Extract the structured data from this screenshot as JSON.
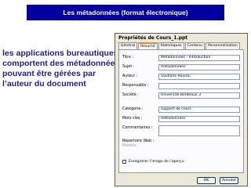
{
  "slide": {
    "title": "Les métadonnées (format électronique)",
    "body_lines": [
      "les applications bureautiques",
      "comportent des métadonnées",
      "pouvant être gérées par",
      "l’auteur du document"
    ]
  },
  "dialog": {
    "title": "Propriétés de Cours_1.ppt",
    "tabs": [
      "Général",
      "Résumé",
      "Statistiques",
      "Contenu",
      "Personnalisation"
    ],
    "fields": {
      "titre": {
        "label": "Titre :",
        "value": "Métadonnées - Introduction"
      },
      "sujet": {
        "label": "Sujet :",
        "value": "métadonnées"
      },
      "auteur": {
        "label": "Auteur :",
        "value": "Soufiane Rouissi"
      },
      "responsable": {
        "label": "Responsable :",
        "value": ""
      },
      "societe": {
        "label": "Société :",
        "value": "Université Bordeaux 3"
      },
      "categorie": {
        "label": "Catégorie :",
        "value": "support de cours"
      },
      "mots_cles": {
        "label": "Mots clés :",
        "value": "métadonnées"
      },
      "commentaires": {
        "label": "Commentaires :",
        "value": ""
      },
      "repertoire": {
        "label": "Répertoire Web :",
        "value": ""
      },
      "modele": {
        "label": "Modèle :",
        "value": ""
      }
    },
    "checkbox_label": "Enregistrer l'image de l'aperçu",
    "ok_label": "OK",
    "cancel_label": "Annuler"
  }
}
